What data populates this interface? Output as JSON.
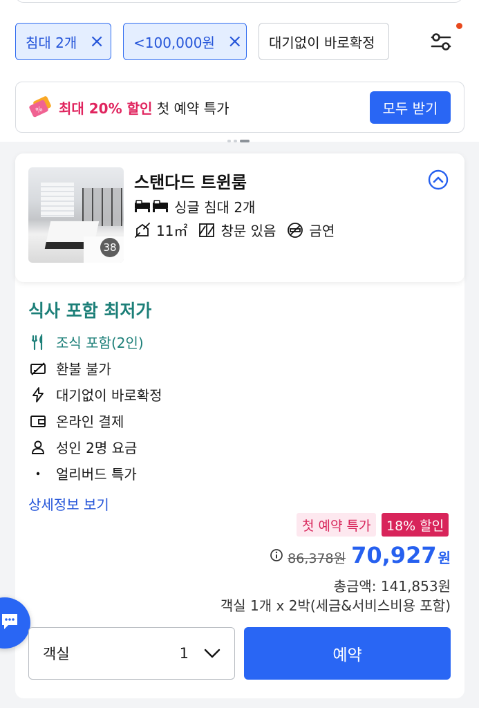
{
  "filters": {
    "chips": [
      {
        "label": "침대 2개",
        "active": true
      },
      {
        "label": "<100,000원",
        "active": true
      },
      {
        "label": "대기없이 바로확정",
        "active": false
      }
    ]
  },
  "promo": {
    "highlight": "최대 20% 할인",
    "text": " 첫 예약 특가",
    "button": "모두 받기"
  },
  "room": {
    "name": "스탠다드 트윈룸",
    "photo_count": "38",
    "bed": "싱글 침대 2개",
    "size": "11㎡",
    "window": "창문 있음",
    "smoking": "금연"
  },
  "plan": {
    "title": "식사 포함 최저가",
    "features": [
      {
        "icon": "utensils-icon",
        "label": "조식 포함(2인)"
      },
      {
        "icon": "no-refund-icon",
        "label": "환불 불가"
      },
      {
        "icon": "lightning-icon",
        "label": "대기없이 바로확정"
      },
      {
        "icon": "wallet-icon",
        "label": "온라인 결제"
      },
      {
        "icon": "person-icon",
        "label": "성인 2명 요금"
      },
      {
        "icon": "bullet-icon",
        "label": "얼리버드 특가"
      }
    ],
    "detail_link": "상세정보 보기"
  },
  "price": {
    "tag_first": "첫 예약 특가",
    "tag_discount": "18% 할인",
    "original": "86,378원",
    "final": "70,927",
    "currency": "원",
    "total": "총금액: 141,853원",
    "breakdown": "객실 1개 x 2박(세금&서비스비용 포함)"
  },
  "booking": {
    "qty_label": "객실",
    "qty_value": "1",
    "book_button": "예약"
  },
  "colors": {
    "accent": "#2966f4",
    "teal": "#1c7f78",
    "pink": "#d8245a"
  }
}
